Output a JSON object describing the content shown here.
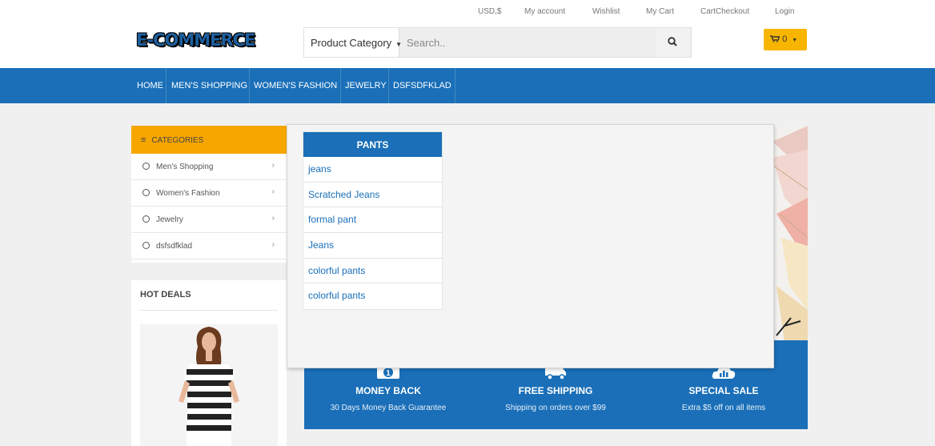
{
  "topbar": {
    "currency": "USD,$",
    "my_account": "My account",
    "wishlist": "Wishlist",
    "my_cart": "My Cart",
    "cart_checkout": "CartCheckout",
    "login": "Login"
  },
  "header": {
    "logo": "E-COMMERCE",
    "category_select": "Product Category",
    "search_placeholder": "Search..",
    "cart_count": "0"
  },
  "nav": {
    "items": [
      "HOME",
      "MEN'S SHOPPING",
      "WOMEN'S FASHION",
      "JEWELRY",
      "DSFSDFKLAD"
    ]
  },
  "sidebar": {
    "categories_title": "CATEGORIES",
    "items": [
      "Men's Shopping",
      "Women's Fashion",
      "Jewelry",
      "dsfsdfklad"
    ]
  },
  "hot_deals": {
    "title": "HOT DEALS"
  },
  "mega_menu": {
    "heading": "PANTS",
    "links": [
      "jeans",
      "Scratched Jeans",
      "formal pant",
      "Jeans",
      "colorful pants",
      "colorful pants"
    ]
  },
  "services": [
    {
      "icon": "money-icon",
      "title": "MONEY BACK",
      "subtitle": "30 Days Money Back Guarantee"
    },
    {
      "icon": "truck-icon",
      "title": "FREE SHIPPING",
      "subtitle": "Shipping on orders over $99"
    },
    {
      "icon": "chart-icon",
      "title": "SPECIAL SALE",
      "subtitle": "Extra $5 off on all items"
    }
  ],
  "colors": {
    "primary": "#1a6fb8",
    "accent": "#f7a600",
    "cart": "#f7b500"
  }
}
